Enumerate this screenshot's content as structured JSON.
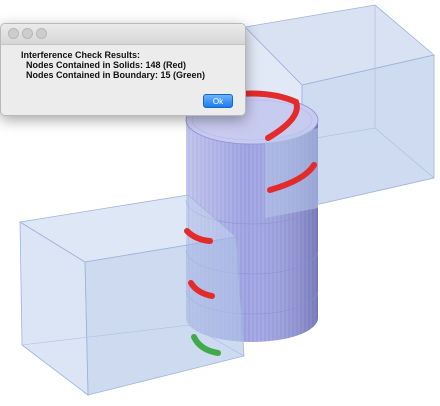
{
  "dialog": {
    "heading": "Interference Check Results:",
    "line_solids": "Nodes Contained in Solids: 148  (Red)",
    "line_boundary": "Nodes Contained in Boundary: 15  (Green)",
    "ok_label": "Ok"
  },
  "colors": {
    "solid_fill": "#bccde9",
    "cylinder": "#a8aee8",
    "red_nodes": "#e32b2b",
    "green_nodes": "#3faa4a",
    "ok_button": "#1a7cf0"
  }
}
